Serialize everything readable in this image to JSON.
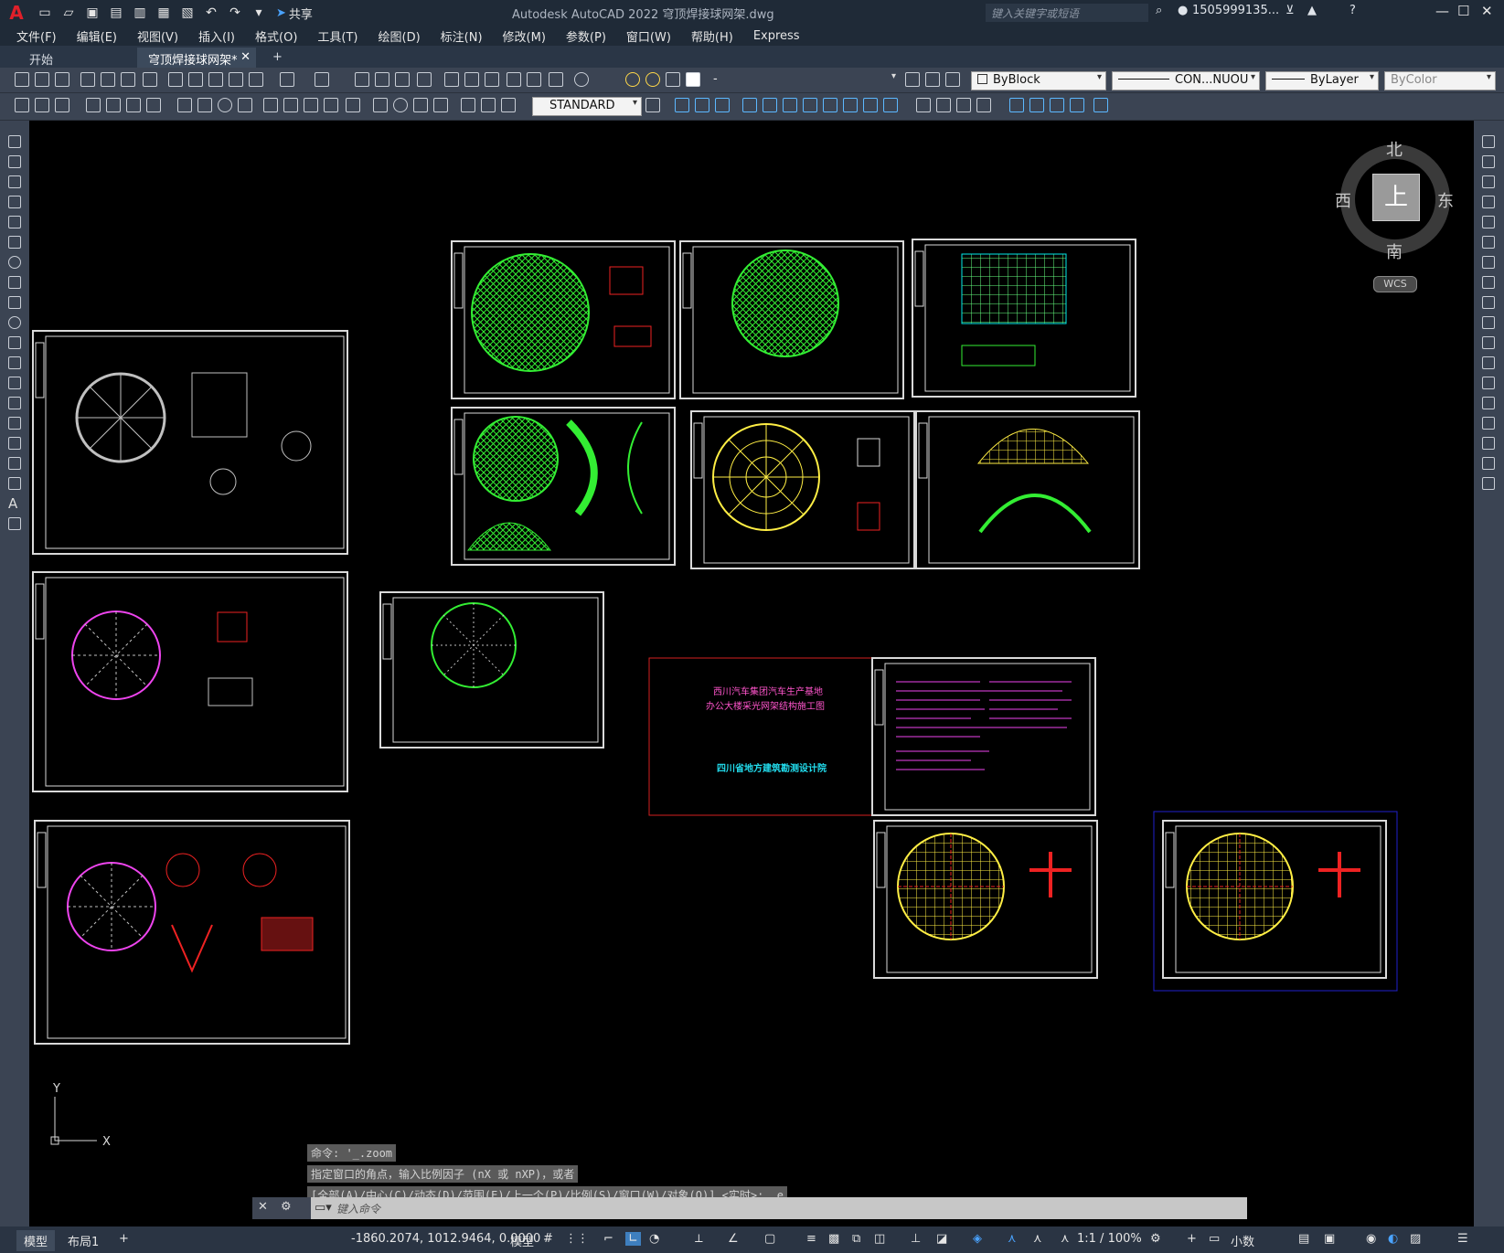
{
  "app": {
    "title": "Autodesk AutoCAD 2022    穹顶焊接球网架.dwg",
    "logo": "A",
    "share_label": "共享",
    "search_placeholder": "键入关键字或短语",
    "user": "1505999135...",
    "win_controls": [
      "—",
      "☐",
      "✕"
    ]
  },
  "menu": [
    "文件(F)",
    "编辑(E)",
    "视图(V)",
    "插入(I)",
    "格式(O)",
    "工具(T)",
    "绘图(D)",
    "标注(N)",
    "修改(M)",
    "参数(P)",
    "窗口(W)",
    "帮助(H)",
    "Express"
  ],
  "tabs": {
    "start": "开始",
    "drawing": "穹顶焊接球网架*",
    "close": "✕",
    "add": "+"
  },
  "toolbar": {
    "layer_value": "-",
    "color_value": "ByBlock",
    "linetype_value": "CON...NUOU",
    "lineweight_value": "ByLayer",
    "plotstyle_value": "ByColor",
    "textstyle_value": "STANDARD"
  },
  "viewcube": {
    "north": "北",
    "south": "南",
    "east": "东",
    "west": "西",
    "top": "上",
    "wcs": "WCS"
  },
  "title_sheet": {
    "line1": "西川汽车集团汽车生产基地",
    "line2": "办公大楼采光网架结构施工图",
    "institute": "四川省地方建筑勘测设计院"
  },
  "command": {
    "history": [
      "命令: '_.zoom",
      "指定窗口的角点，输入比例因子 (nX 或 nXP)，或者",
      "[全部(A)/中心(C)/动态(D)/范围(E)/上一个(P)/比例(S)/窗口(W)/对象(O)] <实时>: _e"
    ],
    "placeholder": "键入命令"
  },
  "ucs": {
    "y": "Y",
    "x": "X"
  },
  "status": {
    "model_tab": "模型",
    "layout_tab": "布局1",
    "add_tab": "+",
    "coords": "-1860.2074, 1012.9464, 0.0000",
    "model_label": "模型",
    "scale": "1:1 / 100%",
    "units": "小数"
  },
  "colors": {
    "green": "#33ee33",
    "yellow": "#ffee44",
    "red": "#ee2222",
    "magenta": "#ee44ee",
    "cyan": "#22ddee",
    "white": "#d9d9d9"
  }
}
